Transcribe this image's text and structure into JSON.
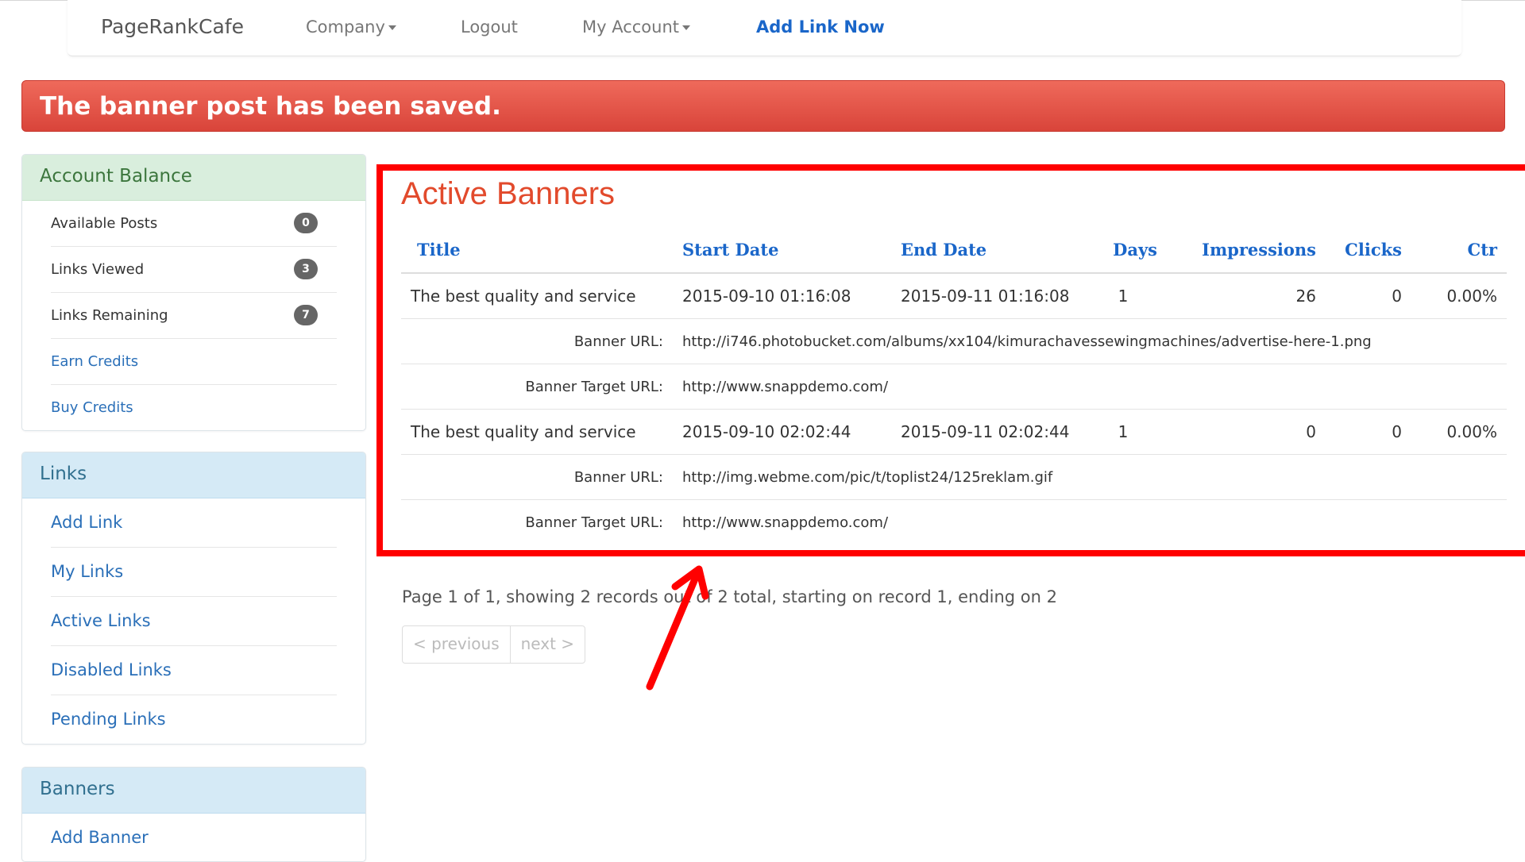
{
  "nav": {
    "brand": "PageRankCafe",
    "company": "Company",
    "logout": "Logout",
    "account": "My Account",
    "cta": "Add Link Now"
  },
  "alert": {
    "text": "The banner post has been saved."
  },
  "balance": {
    "title": "Account Balance",
    "items": [
      {
        "label": "Available Posts",
        "count": "0"
      },
      {
        "label": "Links Viewed",
        "count": "3"
      },
      {
        "label": "Links Remaining",
        "count": "7"
      },
      {
        "label": "Earn Credits"
      },
      {
        "label": "Buy Credits"
      }
    ]
  },
  "links": {
    "title": "Links",
    "items": [
      "Add Link",
      "My Links",
      "Active Links",
      "Disabled Links",
      "Pending Links"
    ]
  },
  "banners_panel": {
    "title": "Banners",
    "items": [
      "Add Banner"
    ]
  },
  "main": {
    "title": "Active Banners",
    "columns": [
      "Title",
      "Start Date",
      "End Date",
      "Days",
      "Impressions",
      "Clicks",
      "Ctr"
    ],
    "rows": [
      {
        "title": "The best quality and service",
        "start": "2015-09-10 01:16:08",
        "end": "2015-09-11 01:16:08",
        "days": "1",
        "impressions": "26",
        "clicks": "0",
        "ctr": "0.00%",
        "banner_url_label": "Banner URL:",
        "banner_url": "http://i746.photobucket.com/albums/xx104/kimurachavessewingmachines/advertise-here-1.png",
        "target_url_label": "Banner Target URL:",
        "target_url": "http://www.snappdemo.com/"
      },
      {
        "title": "The best quality and service",
        "start": "2015-09-10 02:02:44",
        "end": "2015-09-11 02:02:44",
        "days": "1",
        "impressions": "0",
        "clicks": "0",
        "ctr": "0.00%",
        "banner_url_label": "Banner URL:",
        "banner_url": "http://img.webme.com/pic/t/toplist24/125reklam.gif",
        "target_url_label": "Banner Target URL:",
        "target_url": "http://www.snappdemo.com/"
      }
    ],
    "page_info": "Page 1 of 1, showing 2 records out of 2 total, starting on record 1, ending on 2",
    "prev": "< previous",
    "next": "next >"
  },
  "colors": {
    "alert": "#d9443a",
    "highlight": "#ff0000",
    "title": "#e24a2c",
    "link": "#1a66c9"
  }
}
